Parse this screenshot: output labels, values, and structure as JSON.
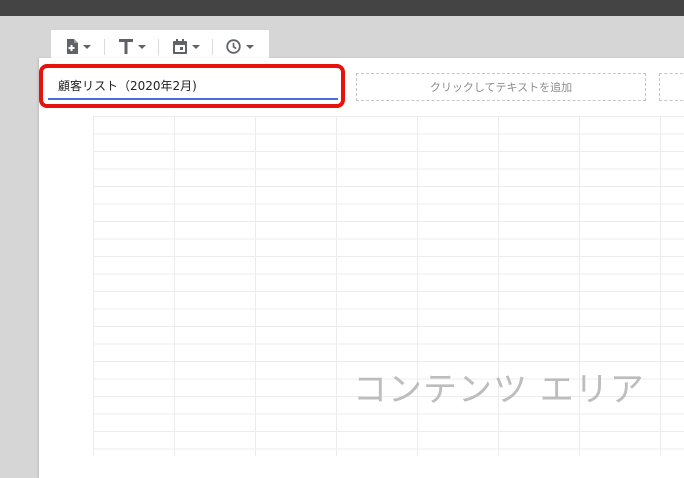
{
  "toolbar": {
    "items": [
      {
        "icon": "add-page-icon"
      },
      {
        "icon": "text-icon"
      },
      {
        "icon": "calendar-icon"
      },
      {
        "icon": "clock-icon"
      }
    ]
  },
  "header": {
    "title_value": "顧客リスト（2020年2月)",
    "text_placeholder": "クリックしてテキストを追加"
  },
  "content": {
    "watermark": "コンテンツ エリア"
  },
  "colors": {
    "highlight": "#e8120c",
    "input_underline": "#4a6fdc"
  }
}
